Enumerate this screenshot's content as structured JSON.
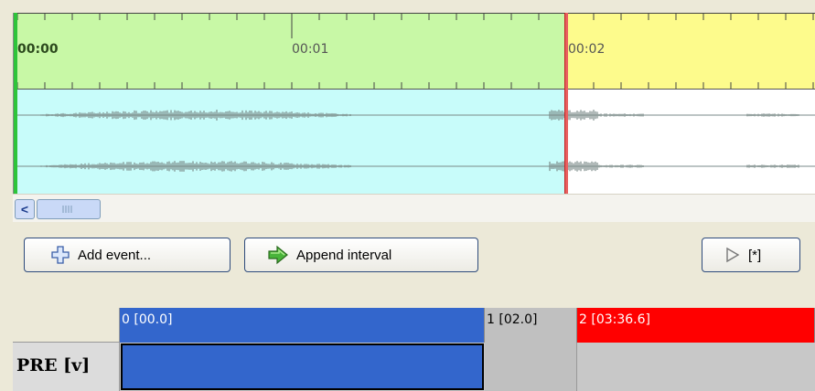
{
  "timeline": {
    "time_labels": [
      "00:00",
      "00:01",
      "00:02"
    ],
    "colors": {
      "ruler_selected": "#c8f8a6",
      "ruler_unselected": "#fdfb8c",
      "wave_selected": "#c8fcfa",
      "wave_unselected": "#ffffff",
      "playhead": "#e86060",
      "start_marker": "#2ec43a"
    }
  },
  "scrollbar": {
    "left_arrow_icon": "chevron-left-icon",
    "left_arrow_glyph": "<"
  },
  "toolbar": {
    "add_event_label": "Add event...",
    "add_event_icon": "plus-icon",
    "append_interval_label": "Append interval",
    "append_interval_icon": "arrow-right-icon",
    "play_label": "[*]",
    "play_icon": "play-icon"
  },
  "tiers": {
    "segments": [
      {
        "label": "0 [00.0]",
        "color": "#3366cc"
      },
      {
        "label": "1 [02.0]",
        "color": "#c0c0c0"
      },
      {
        "label": "2 [03:36.6]",
        "color": "#ff0000"
      }
    ],
    "tier_name": "PRE [v]"
  }
}
